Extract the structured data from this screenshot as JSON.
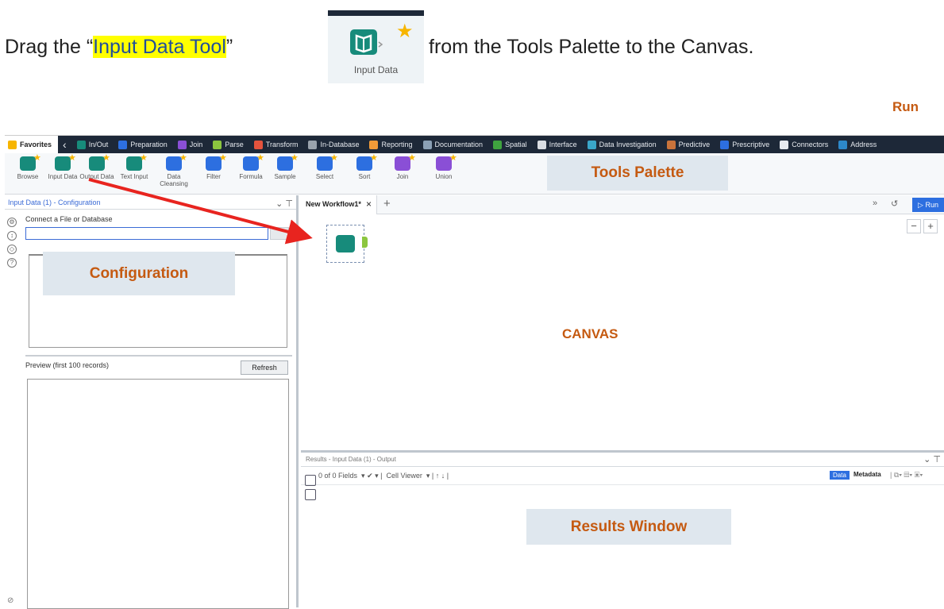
{
  "instruction": {
    "prefix": "Drag the “",
    "highlight": "Input Data Tool",
    "suffix": "”",
    "rest": "from the Tools Palette to the Canvas."
  },
  "hero_tool": {
    "label": "Input Data",
    "icon": "book-icon",
    "color": "#178b7b"
  },
  "callouts": {
    "run": "Run",
    "tools_palette": "Tools Palette",
    "configuration": "Configuration",
    "canvas": "CANVAS",
    "results_window": "Results Window"
  },
  "categories": [
    {
      "label": "Favorites",
      "color": "#f7b500"
    },
    {
      "label": "In/Out",
      "color": "#178b7b"
    },
    {
      "label": "Preparation",
      "color": "#2d6fe0"
    },
    {
      "label": "Join",
      "color": "#8a4fd6"
    },
    {
      "label": "Parse",
      "color": "#8cc63f"
    },
    {
      "label": "Transform",
      "color": "#e5533d"
    },
    {
      "label": "In-Database",
      "color": "#9aa3ad"
    },
    {
      "label": "Reporting",
      "color": "#f29b38"
    },
    {
      "label": "Documentation",
      "color": "#8ba0b5"
    },
    {
      "label": "Spatial",
      "color": "#3fa33f"
    },
    {
      "label": "Interface",
      "color": "#d9dde2"
    },
    {
      "label": "Data Investigation",
      "color": "#3aa6c9"
    },
    {
      "label": "Predictive",
      "color": "#c9733b"
    },
    {
      "label": "Prescriptive",
      "color": "#2d6fe0"
    },
    {
      "label": "Connectors",
      "color": "#e7eaef"
    },
    {
      "label": "Address",
      "color": "#2d88c9"
    }
  ],
  "palette_tools": [
    {
      "label": "Browse",
      "color": "#178b7b"
    },
    {
      "label": "Input Data",
      "color": "#178b7b"
    },
    {
      "label": "Output Data",
      "color": "#178b7b"
    },
    {
      "label": "Text Input",
      "color": "#178b7b"
    },
    {
      "label": "Data Cleansing",
      "color": "#2d6fe0"
    },
    {
      "label": "Filter",
      "color": "#2d6fe0"
    },
    {
      "label": "Formula",
      "color": "#2d6fe0"
    },
    {
      "label": "Sample",
      "color": "#2d6fe0"
    },
    {
      "label": "Select",
      "color": "#2d6fe0"
    },
    {
      "label": "Sort",
      "color": "#2d6fe0"
    },
    {
      "label": "Join",
      "color": "#8a4fd6"
    },
    {
      "label": "Union",
      "color": "#8a4fd6"
    }
  ],
  "config": {
    "title": "Input Data (1) - Configuration",
    "connect_label": "Connect a File or Database",
    "connect_value": "",
    "preview_label": "Preview (first 100 records)",
    "refresh_label": "Refresh"
  },
  "workspace": {
    "tab_label": "New Workflow1*",
    "tab_close": "×",
    "add_tab": "+",
    "run_label": "Run",
    "zoom_out": "−",
    "zoom_in": "+"
  },
  "results": {
    "title": "Results - Input Data (1) - Output",
    "fields_text": "0 of 0 Fields",
    "cell_viewer": "Cell Viewer",
    "data_tab": "Data",
    "metadata_tab": "Metadata"
  }
}
